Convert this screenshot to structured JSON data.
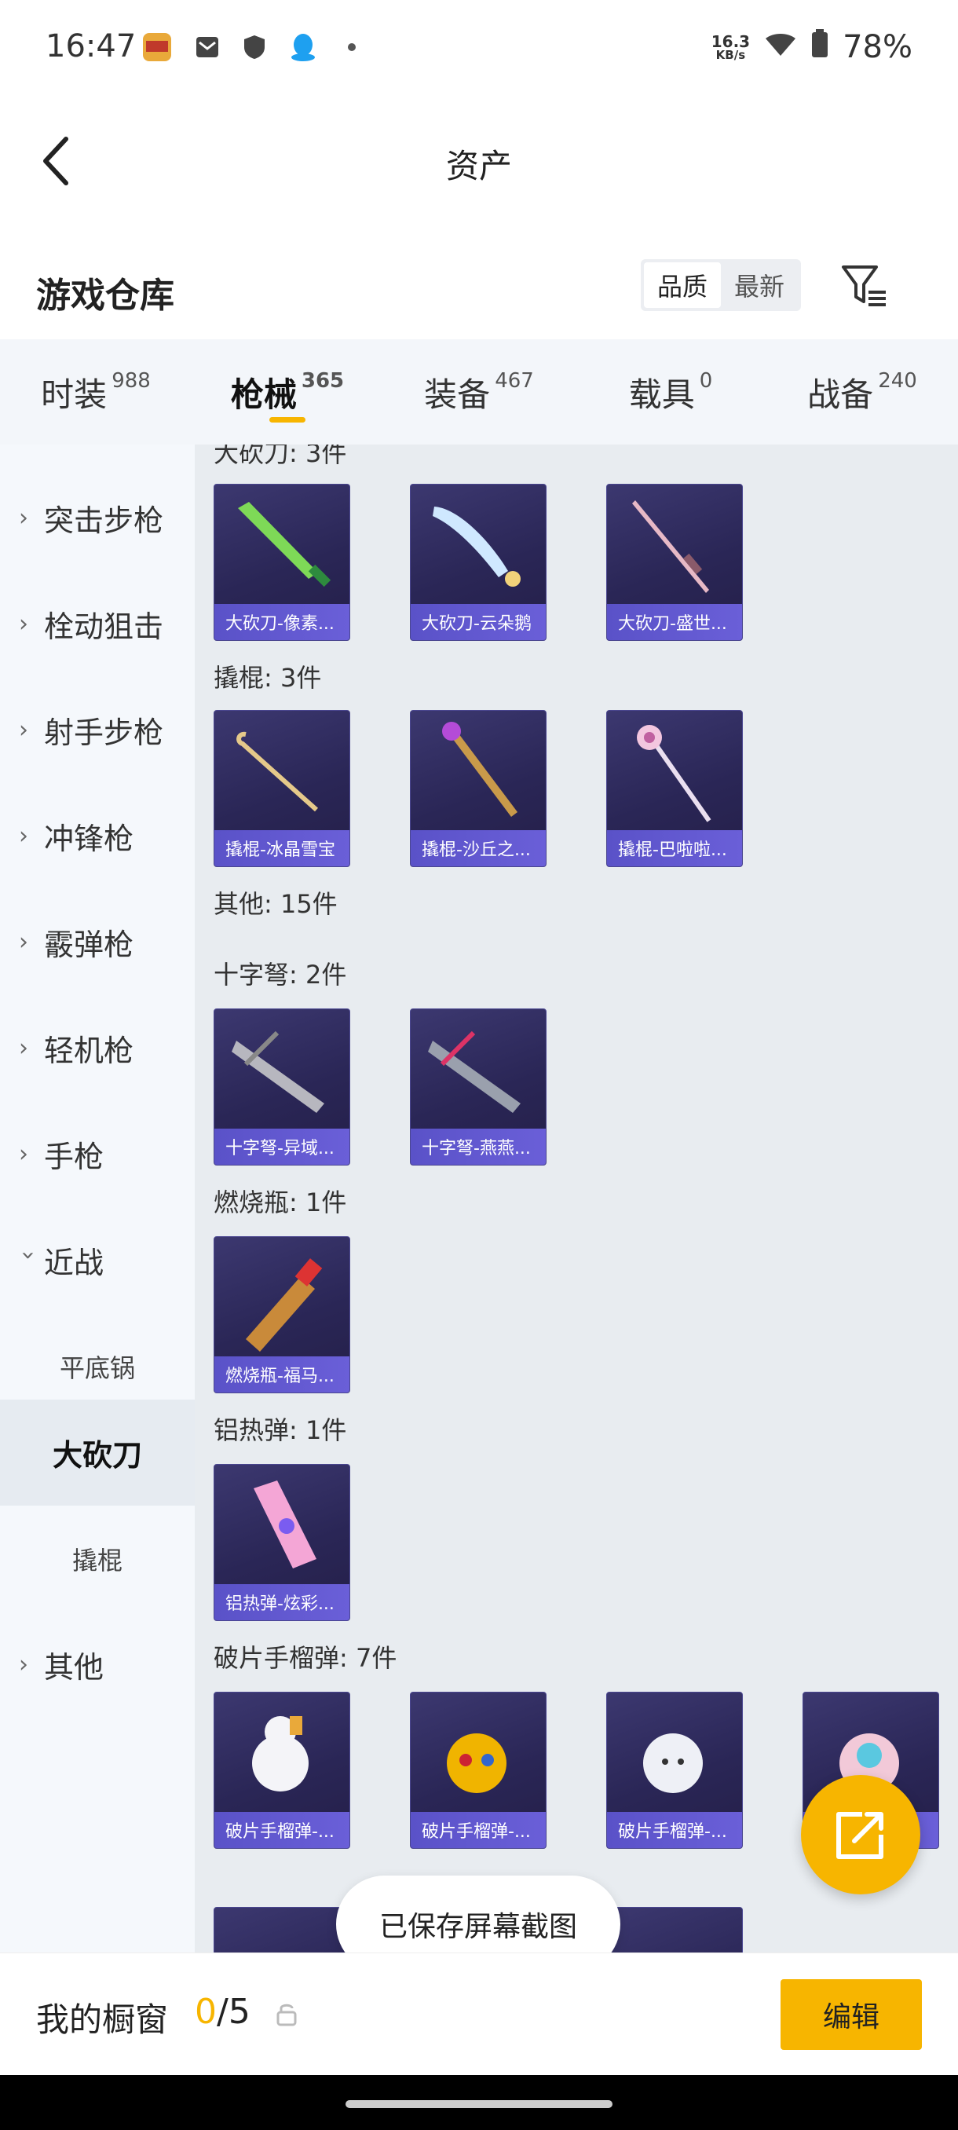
{
  "status": {
    "time": "16:47",
    "speed": "16.3",
    "speed_unit": "KB/s",
    "battery": "78%"
  },
  "header": {
    "title": "资产",
    "section_title": "游戏仓库",
    "sort": [
      "品质",
      "最新"
    ]
  },
  "tabs": [
    {
      "label": "时装",
      "count": "988"
    },
    {
      "label": "枪械",
      "count": "365"
    },
    {
      "label": "装备",
      "count": "467"
    },
    {
      "label": "载具",
      "count": "0"
    },
    {
      "label": "战备",
      "count": "240"
    }
  ],
  "sidebar": {
    "items": [
      "突击步枪",
      "栓动狙击",
      "射手步枪",
      "冲锋枪",
      "霰弹枪",
      "轻机枪",
      "手枪",
      "近战",
      "平底锅",
      "大砍刀",
      "撬棍",
      "其他"
    ]
  },
  "groups": {
    "g0": "大砍刀: 3件",
    "g1": "撬棍: 3件",
    "g2": "其他: 15件",
    "g3": "十字弩: 2件",
    "g4": "燃烧瓶: 1件",
    "g5": "铝热弹: 1件",
    "g6": "破片手榴弹: 7件"
  },
  "cards": {
    "c0": "大砍刀-像素...",
    "c1": "大砍刀-云朵鹅",
    "c2": "大砍刀-盛世...",
    "c3": "撬棍-冰晶雪宝",
    "c4": "撬棍-沙丘之...",
    "c5": "撬棍-巴啦啦...",
    "c6": "十字弩-异域...",
    "c7": "十字弩-燕燕...",
    "c8": "燃烧瓶-福马...",
    "c9": "铝热弹-炫彩...",
    "c10": "破片手榴弹-...",
    "c11": "破片手榴弹-...",
    "c12": "破片手榴弹-...",
    "c13": "..."
  },
  "toast": "已保存屏幕截图",
  "bottom": {
    "showcase_label": "我的橱窗",
    "showcase_current": "0",
    "showcase_total": "/5",
    "edit_label": "编辑"
  },
  "colors": {
    "accent": "#f7b500",
    "card_caption": "#5a52c8"
  }
}
